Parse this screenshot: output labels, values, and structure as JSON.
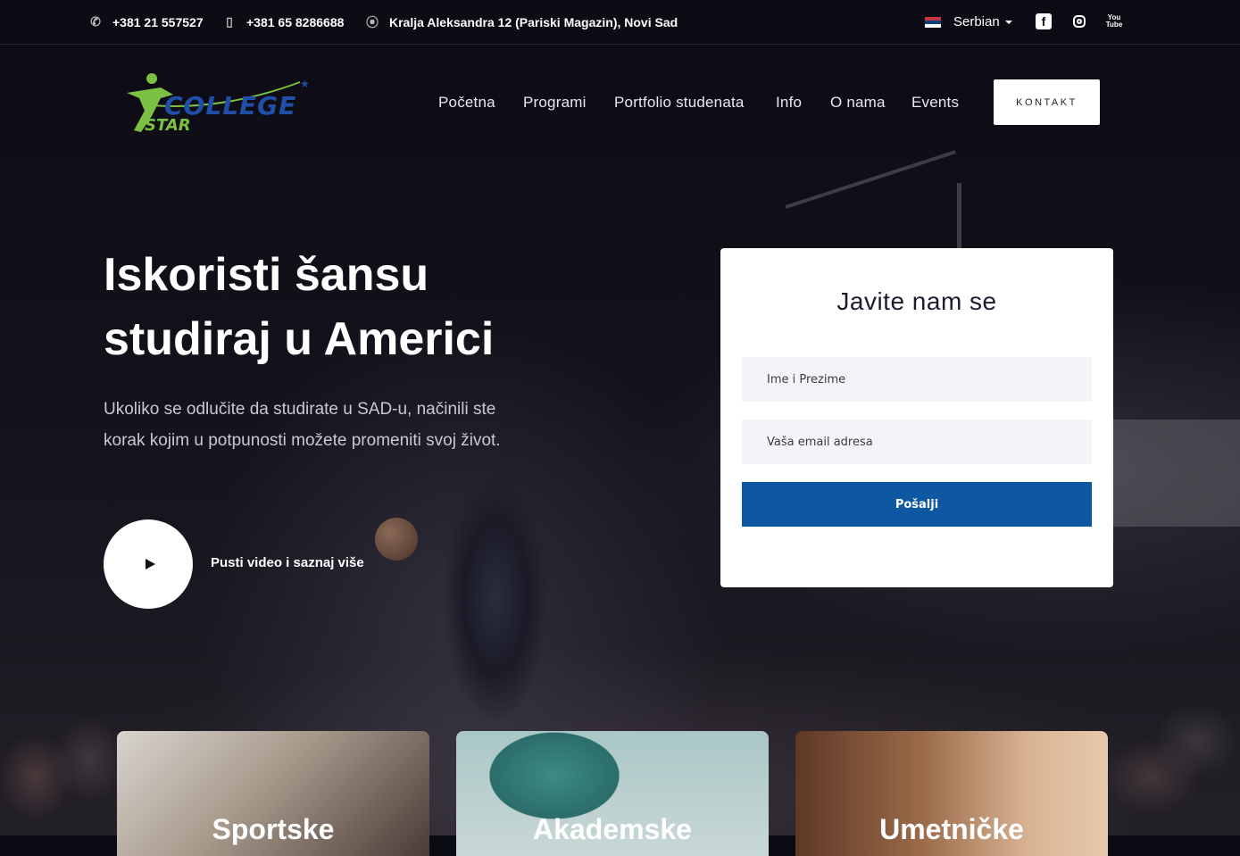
{
  "topbar": {
    "phone1": "+381 21 557527",
    "phone2": "+381 65 8286688",
    "address": "Kralja Aleksandra 12 (Pariski Magazin), Novi Sad",
    "language": "Serbian"
  },
  "logo": {
    "line1": "COLLEGE",
    "line2": "STAR",
    "text_color": "#1f4fa8",
    "figure_color": "#7bc043"
  },
  "nav": {
    "items": [
      "Početna",
      "Programi",
      "Portfolio studenata",
      "Info",
      "O nama",
      "Events"
    ],
    "cta": "KONTAKT"
  },
  "hero": {
    "title_line1": "Iskoristi šansu",
    "title_line2": "studiraj u Americi",
    "lead": "Ukoliko se odlučite da studirate u SAD-u, načinili ste korak kojim u potpunosti možete promeniti svoj život.",
    "video_label": "Pusti video i saznaj više"
  },
  "contact_form": {
    "title": "Javite nam se",
    "name_placeholder": "Ime i Prezime",
    "email_placeholder": "Vaša email adresa",
    "submit": "Pošalji",
    "submit_color": "#0d57a3"
  },
  "program_cards": [
    {
      "label": "Sportske"
    },
    {
      "label": "Akademske"
    },
    {
      "label": "Umetničke"
    }
  ]
}
